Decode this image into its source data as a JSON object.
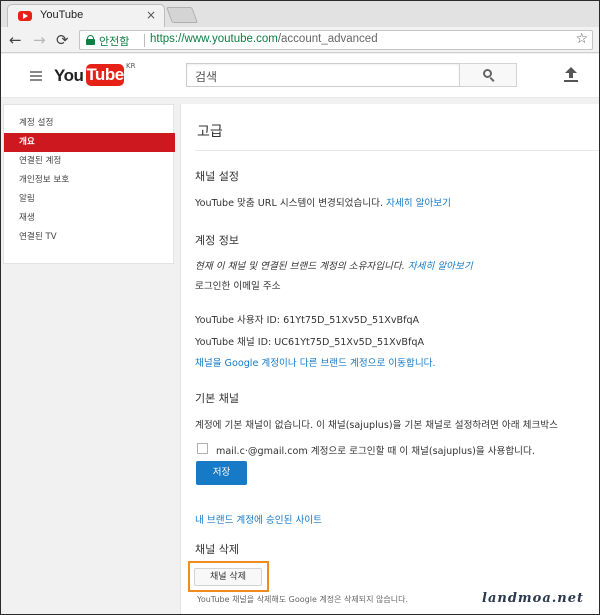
{
  "browser": {
    "tab_title": "YouTube",
    "tab_close": "×",
    "secure_label": "안전함",
    "url_scheme_host": "https://www.youtube.com",
    "url_path": "/account_advanced",
    "back_glyph": "←",
    "forward_glyph": "→",
    "reload_glyph": "⟳",
    "star_glyph": "☆"
  },
  "masthead": {
    "logo_you": "You",
    "logo_tube": "Tube",
    "logo_region": "KR",
    "search_placeholder": "검색"
  },
  "sidebar": {
    "items": [
      {
        "label": "계정 설정",
        "active": false
      },
      {
        "label": "개요",
        "active": true
      },
      {
        "label": "연결된 계정",
        "active": false
      },
      {
        "label": "개인정보 보호",
        "active": false
      },
      {
        "label": "알림",
        "active": false
      },
      {
        "label": "재생",
        "active": false
      },
      {
        "label": "연결된 TV",
        "active": false
      }
    ]
  },
  "main": {
    "title": "고급",
    "channel_settings": {
      "heading": "채널 설정",
      "text": "YouTube 맞춤 URL 시스템이 변경되었습니다.",
      "link": "자세히 알아보기"
    },
    "account_info": {
      "heading": "계정 정보",
      "owner_text": "현재 이 채널 및 연결된 브랜드 계정의 소유자입니다.",
      "owner_link": "자세히 알아보기",
      "email_label": "로그인한 이메일 주소",
      "user_id": "YouTube 사용자 ID: 61Yt75D_51Xv5D_51XvBfqA",
      "channel_id": "YouTube 채널 ID: UC61Yt75D_51Xv5D_51XvBfqA",
      "move_link": "채널을 Google 계정이나 다른 브랜드 계정으로 이동합니다."
    },
    "default_channel": {
      "heading": "기본 채널",
      "text": "계정에 기본 채널이 없습니다. 이 채널(sajuplus)을 기본 채널로 설정하려면 아래 체크박스",
      "checkbox_label": "mail.c·@gmail.com 계정으로 로그인할 때 이 채널(sajuplus)을 사용합니다.",
      "save_label": "저장"
    },
    "approved_sites_link": "내 브랜드 계정에 승인된 사이트",
    "delete_channel": {
      "heading": "채널 삭제",
      "button_label": "채널 삭제",
      "footnote": "YouTube 채널을 삭제해도 Google 계정은 삭제되지 않습니다."
    }
  },
  "watermark": "landmoa.net",
  "colors": {
    "accent_red": "#cc181e",
    "link_blue": "#167ac6",
    "highlight_orange": "#f08c1e",
    "secure_green": "#0b8043"
  }
}
